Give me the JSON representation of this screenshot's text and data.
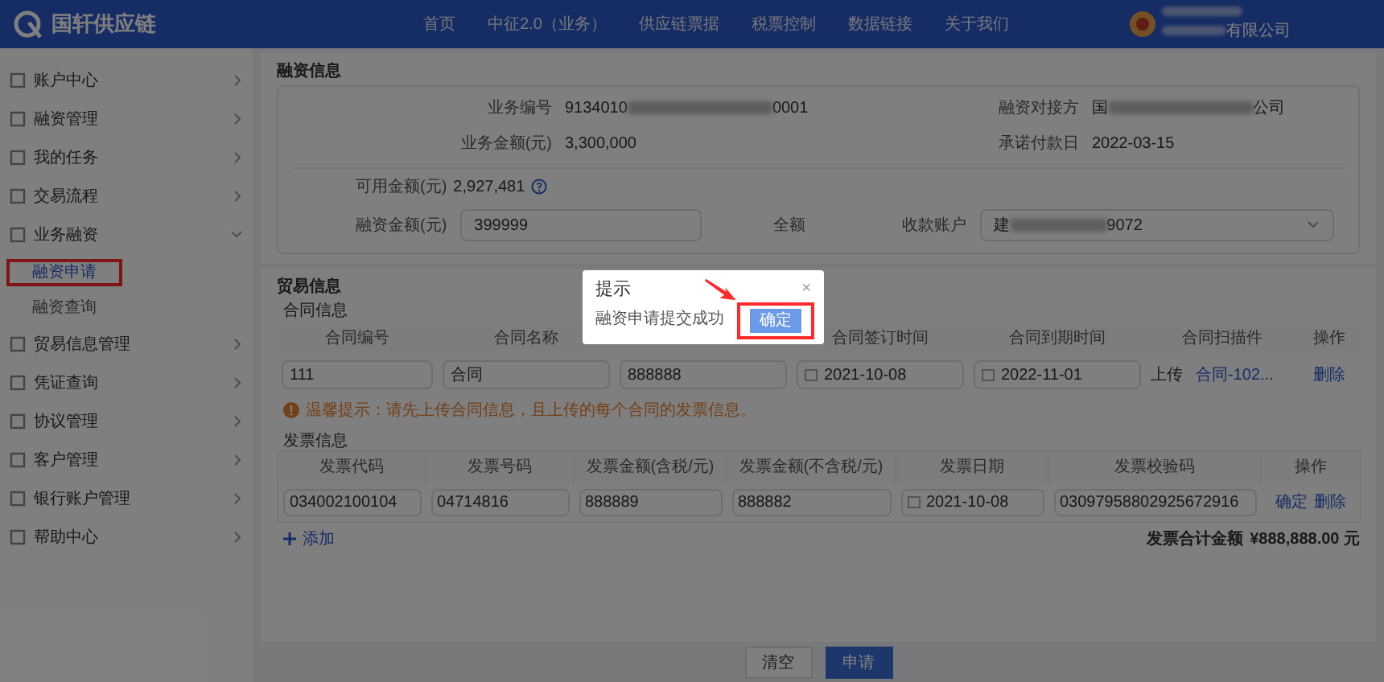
{
  "header": {
    "logo_text": "国轩供应链",
    "nav": [
      {
        "label": "首页"
      },
      {
        "label": "中征2.0（业务）"
      },
      {
        "label": "供应链票据"
      },
      {
        "label": "税票控制"
      },
      {
        "label": "数据链接"
      },
      {
        "label": "关于我们"
      }
    ],
    "user": {
      "company_end": "有限公司"
    }
  },
  "sidebar": {
    "items": [
      {
        "label": "账户中心",
        "expanded": false
      },
      {
        "label": "融资管理",
        "expanded": false
      },
      {
        "label": "我的任务",
        "expanded": false
      },
      {
        "label": "交易流程",
        "expanded": false
      },
      {
        "label": "业务融资",
        "expanded": true,
        "children": [
          {
            "label": "融资申请",
            "selected": true,
            "highlighted": true
          },
          {
            "label": "融资查询",
            "selected": false,
            "highlighted": false
          }
        ]
      },
      {
        "label": "贸易信息管理",
        "expanded": false
      },
      {
        "label": "凭证查询",
        "expanded": false
      },
      {
        "label": "协议管理",
        "expanded": false
      },
      {
        "label": "客户管理",
        "expanded": false
      },
      {
        "label": "银行账户管理",
        "expanded": false
      },
      {
        "label": "帮助中心",
        "expanded": false
      }
    ]
  },
  "financing": {
    "title": "融资信息",
    "fields": [
      {
        "label": "业务编号",
        "value": "9134010",
        "value_end": "0001",
        "redacted": true
      },
      {
        "label": "融资对接方",
        "value": "国",
        "value_end": "公司",
        "redacted": true
      },
      {
        "label": "业务金额(元)",
        "value": "3,300,000",
        "redacted": false
      },
      {
        "label": "承诺付款日",
        "value": "2022-03-15",
        "redacted": false
      }
    ],
    "available": {
      "label": "可用金额(元)",
      "value": "2,927,481"
    },
    "amount": {
      "label": "融资金额(元)",
      "value": "399999",
      "full_label": "全额"
    },
    "account": {
      "label": "收款账户",
      "value": "建",
      "value_end": "9072"
    }
  },
  "trade": {
    "title": "贸易信息",
    "contracts": {
      "title": "合同信息",
      "columns": [
        "合同编号",
        "合同名称",
        "",
        "合同签订时间",
        "合同到期时间",
        "合同扫描件",
        "操作"
      ],
      "rows": [
        {
          "number": "111",
          "name": "合同",
          "amount": "888888",
          "signed": "2021-10-08",
          "due": "2022-11-01",
          "upload": "上传",
          "file": "合同-102...",
          "action": "删除"
        }
      ]
    },
    "warning": "温馨提示：请先上传合同信息，且上传的每个合同的发票信息。",
    "invoices": {
      "title": "发票信息",
      "columns": [
        "发票代码",
        "发票号码",
        "发票金额(含税/元)",
        "发票金额(不含税/元)",
        "发票日期",
        "发票校验码",
        "操作"
      ],
      "rows": [
        {
          "code": "034002100104",
          "number": "04714816",
          "amount_tax": "888889",
          "amount_net": "888882",
          "date": "2021-10-08",
          "check": "03097958802925672916",
          "confirm": "确定",
          "delete": "删除"
        }
      ]
    },
    "add_label": "添加",
    "total_label": "发票合计金额",
    "total_value": "¥888,888.00 元"
  },
  "footer_buttons": [
    {
      "label": "清空",
      "kind": "secondary"
    },
    {
      "label": "申请",
      "kind": "primary"
    }
  ],
  "modal": {
    "title": "提示",
    "close": "×",
    "message": "融资申请提交成功",
    "button": "确定",
    "button_highlighted": true,
    "arrow": true
  }
}
